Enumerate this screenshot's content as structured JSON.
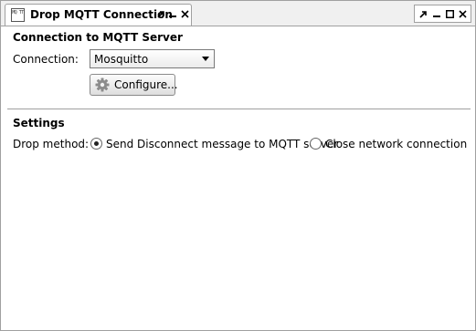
{
  "tab": {
    "icon_text": "MQ TT",
    "title": "Drop MQTT Connection"
  },
  "connection_section": {
    "title": "Connection to MQTT Server",
    "connection_label": "Connection:",
    "connection_value": "Mosquitto",
    "configure_label": "Configure..."
  },
  "settings_section": {
    "title": "Settings",
    "drop_method_label": "Drop method:",
    "options": [
      {
        "label": "Send Disconnect message to MQTT server",
        "selected": true
      },
      {
        "label": "Close network connection",
        "selected": false
      }
    ]
  }
}
